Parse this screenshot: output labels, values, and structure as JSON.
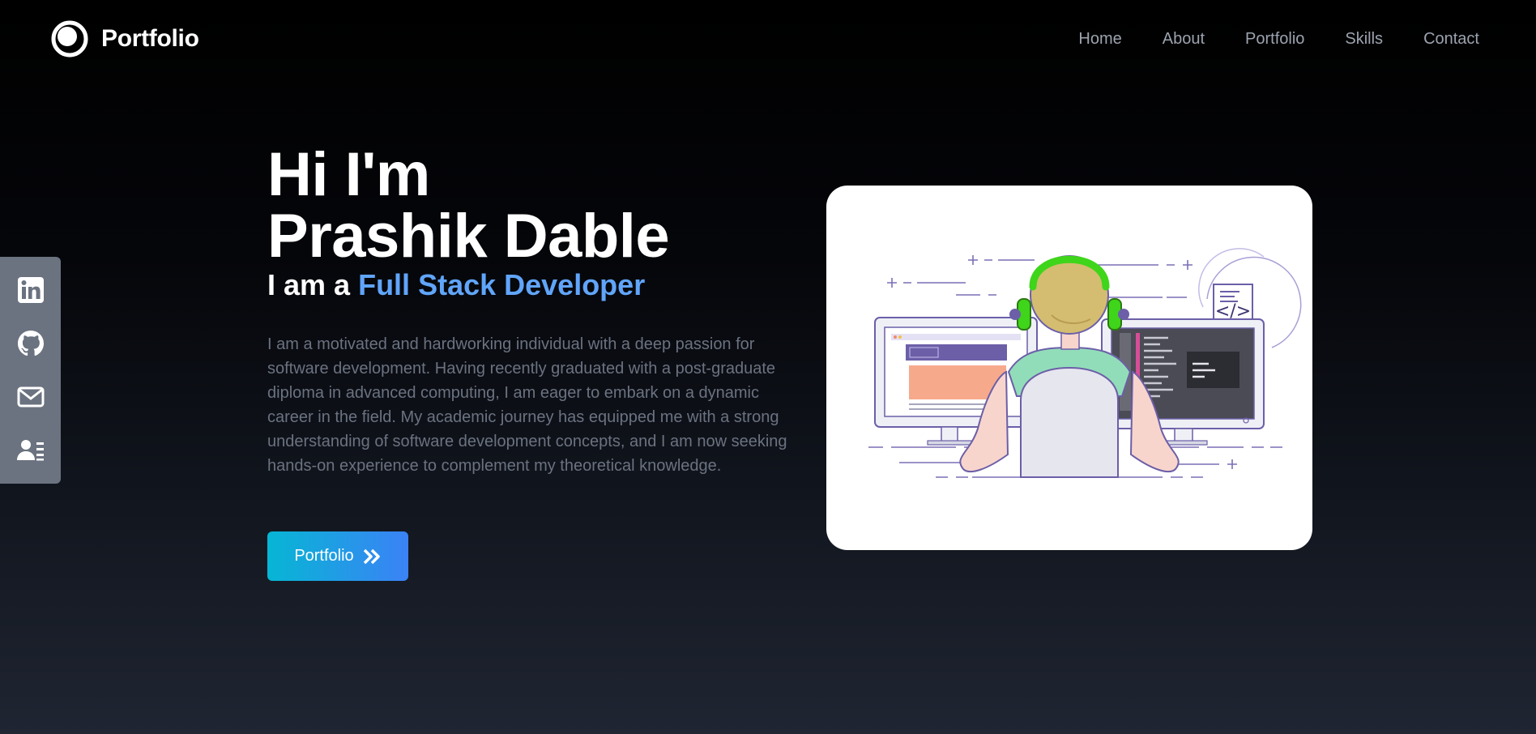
{
  "brand": {
    "name": "Portfolio",
    "logo_icon": "circle-logo-icon"
  },
  "nav": {
    "items": [
      {
        "label": "Home"
      },
      {
        "label": "About"
      },
      {
        "label": "Portfolio"
      },
      {
        "label": "Skills"
      },
      {
        "label": "Contact"
      }
    ]
  },
  "social": {
    "items": [
      {
        "icon": "linkedin-icon"
      },
      {
        "icon": "github-icon"
      },
      {
        "icon": "mail-icon"
      },
      {
        "icon": "resume-icon"
      }
    ]
  },
  "hero": {
    "greeting": "Hi I'm",
    "name": "Prashik Dable",
    "role_prefix": "I am a",
    "role_accent": "Full Stack Developer",
    "bio": "I am a motivated and hardworking individual with a deep passion for software development. Having recently graduated with a post-graduate diploma in advanced computing, I am eager to embark on a dynamic career in the field. My academic journey has equipped me with a strong understanding of software development concepts, and I am now seeking hands-on experience to complement my theoretical knowledge.",
    "cta_label": "Portfolio",
    "cta_icon": "double-chevron-right-icon"
  },
  "illustration": {
    "code_tag": "</>"
  },
  "colors": {
    "accent": "#60a5fa",
    "button_from": "#06b6d4",
    "button_to": "#3b82f6",
    "sidebar": "#6b7280"
  }
}
